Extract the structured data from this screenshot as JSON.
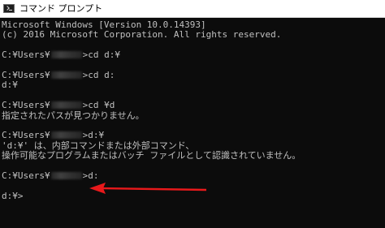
{
  "window": {
    "title": "コマンド プロンプト",
    "icon": "console-app-icon"
  },
  "console": {
    "lines": [
      {
        "parts": [
          "Microsoft Windows [Version 10.0.14393]"
        ]
      },
      {
        "parts": [
          "(c) 2016 Microsoft Corporation. All rights reserved."
        ]
      },
      {
        "parts": [
          ""
        ]
      },
      {
        "parts": [
          "C:¥Users¥",
          "{mask}",
          ">cd d:¥"
        ]
      },
      {
        "parts": [
          ""
        ]
      },
      {
        "parts": [
          "C:¥Users¥",
          "{mask}",
          ">cd d:"
        ]
      },
      {
        "parts": [
          "d:¥"
        ]
      },
      {
        "parts": [
          ""
        ]
      },
      {
        "parts": [
          "C:¥Users¥",
          "{mask}",
          ">cd ¥d"
        ]
      },
      {
        "parts": [
          "指定されたパスが見つかりません。"
        ]
      },
      {
        "parts": [
          ""
        ]
      },
      {
        "parts": [
          "C:¥Users¥",
          "{mask}",
          ">d:¥"
        ]
      },
      {
        "parts": [
          "'d:¥' は、内部コマンドまたは外部コマンド、"
        ]
      },
      {
        "parts": [
          "操作可能なプログラムまたはバッチ ファイルとして認識されていません。"
        ]
      },
      {
        "parts": [
          ""
        ]
      },
      {
        "parts": [
          "C:¥Users¥",
          "{mask}",
          ">d:"
        ]
      },
      {
        "parts": [
          ""
        ]
      },
      {
        "parts": [
          "d:¥>"
        ]
      }
    ]
  },
  "colors": {
    "console_bg": "#0c0c0c",
    "console_fg": "#c0c0c0",
    "arrow": "#e8191b",
    "titlebar_bg": "#ffffff"
  }
}
